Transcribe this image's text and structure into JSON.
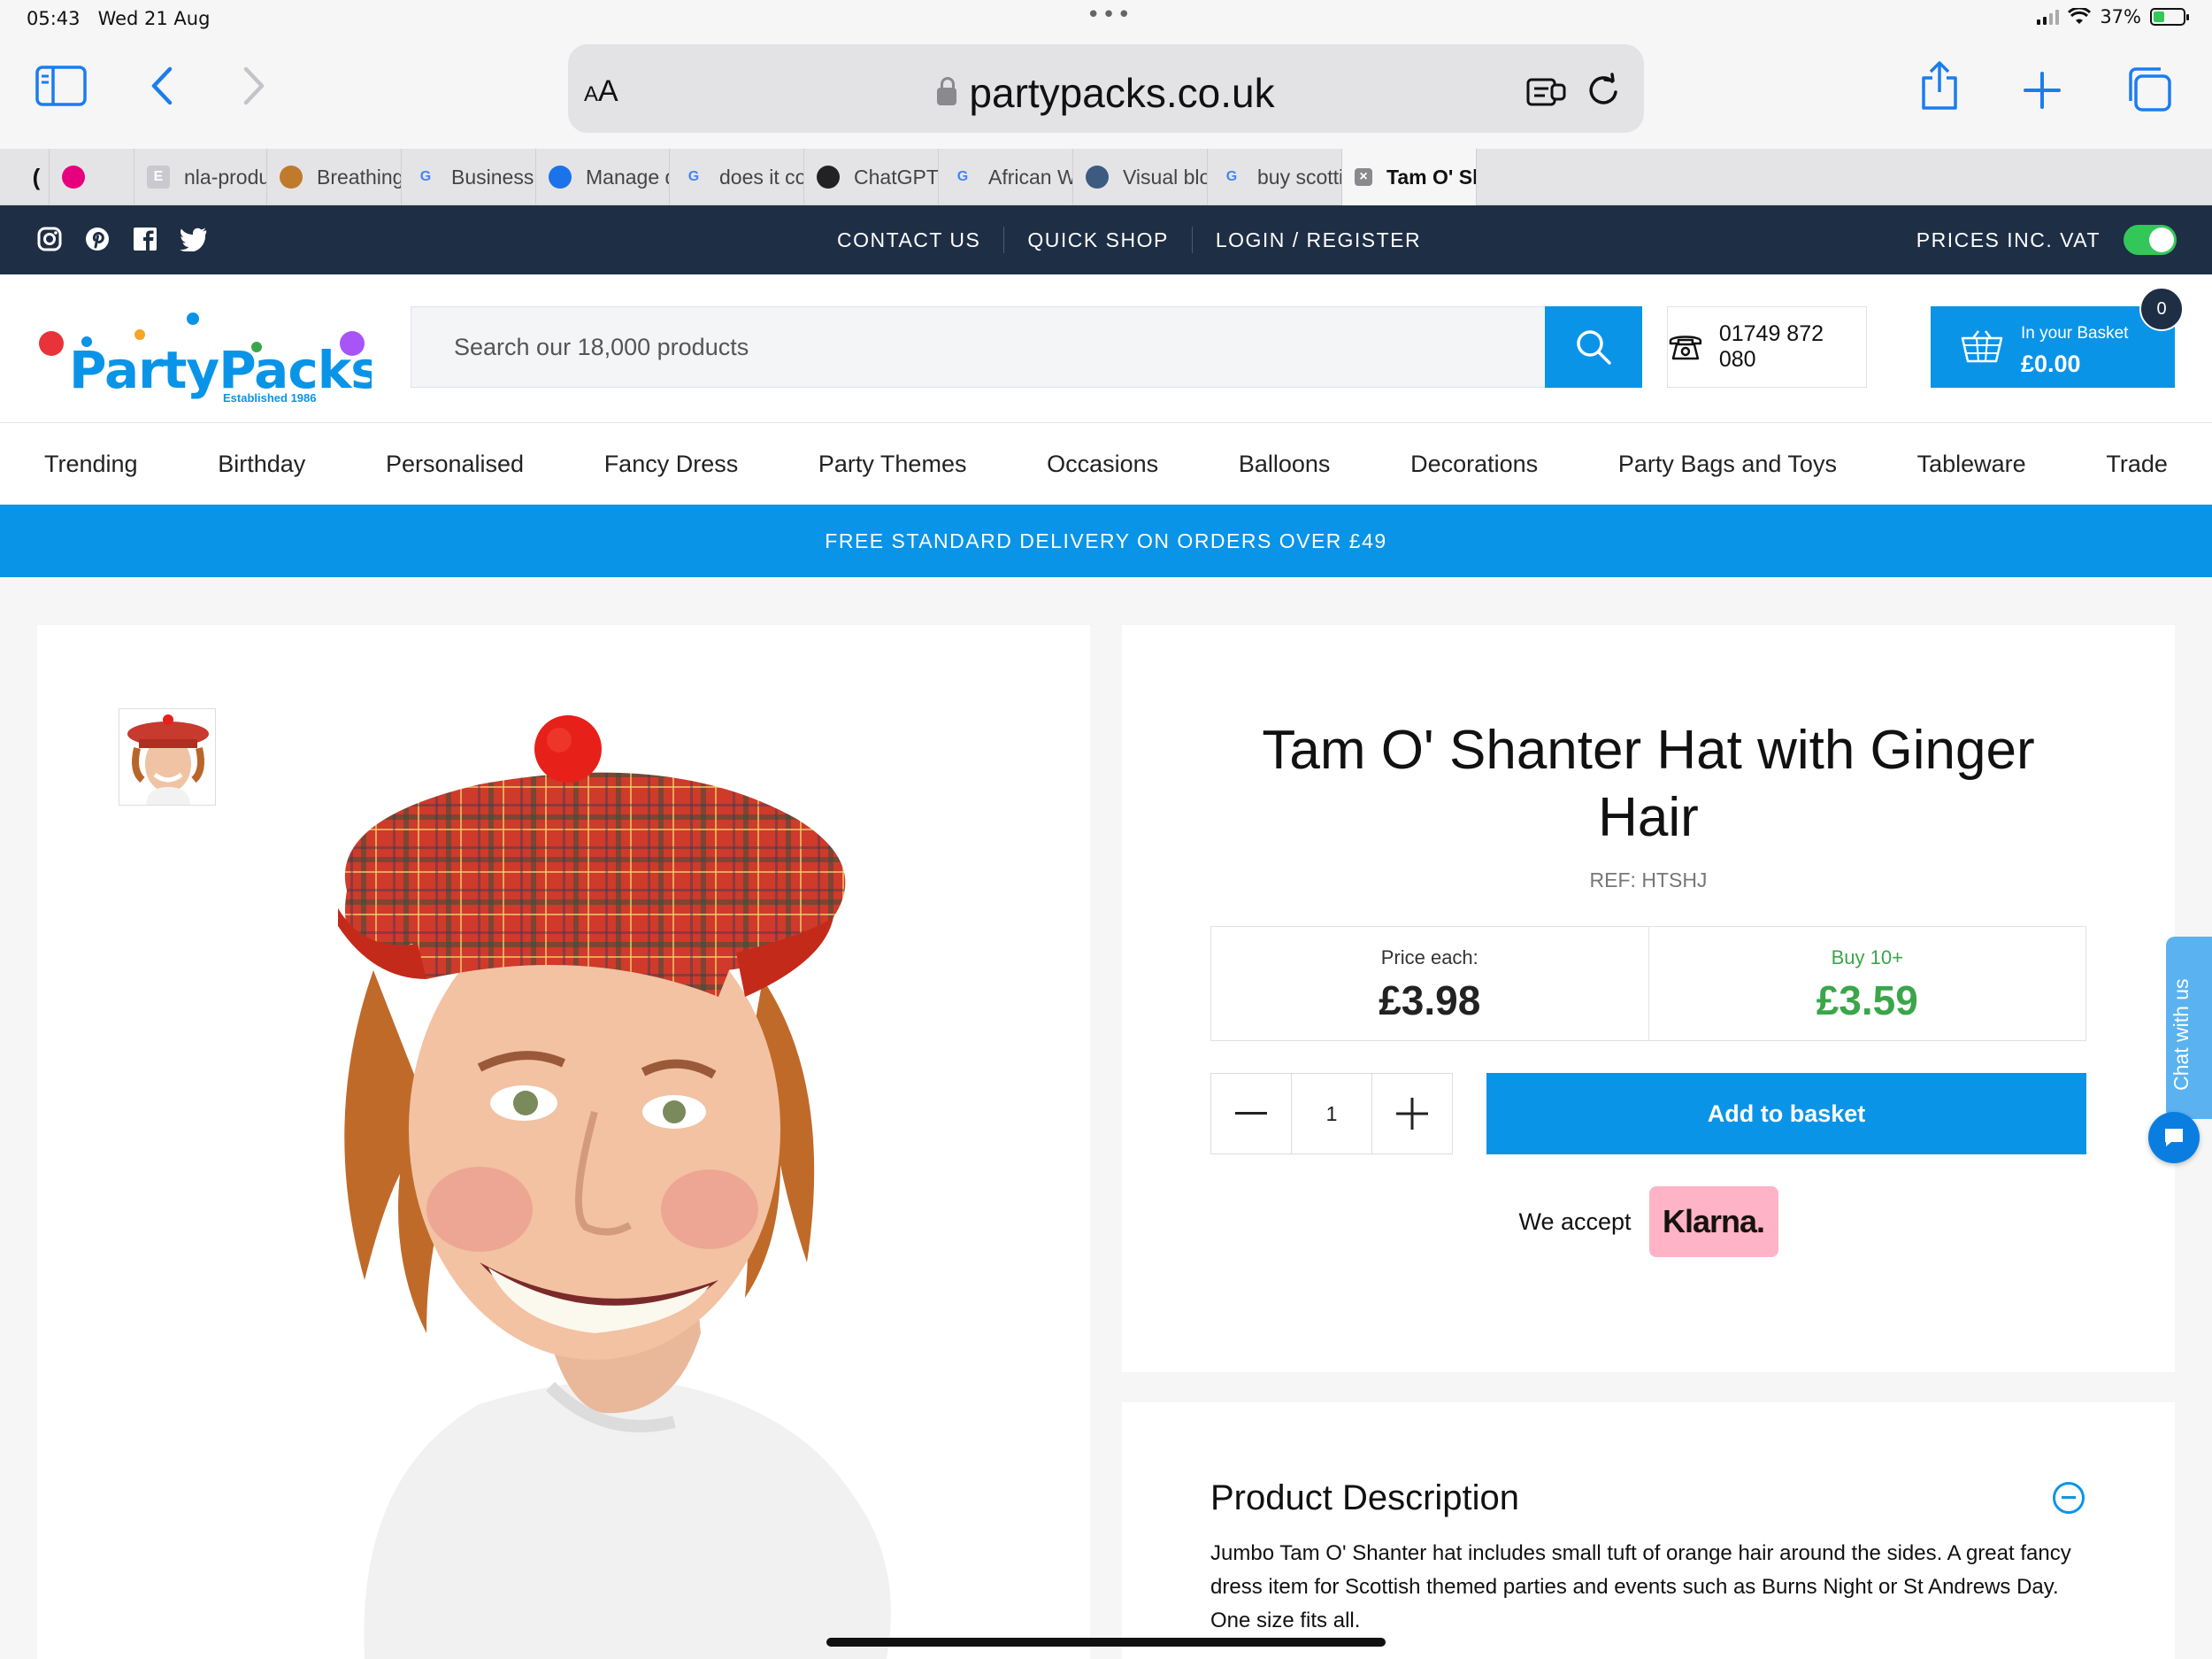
{
  "status_bar": {
    "time": "05:43",
    "date": "Wed 21 Aug",
    "battery": "37%",
    "battery_level": 0.37
  },
  "browser": {
    "aa_label": "AA",
    "url": "partypacks.co.uk",
    "tabs": [
      {
        "label": "",
        "favicon": "tab-favicon-c",
        "color": "#111111"
      },
      {
        "label": "",
        "favicon": "nla-icon",
        "color": "#e6007e"
      },
      {
        "label": "nla-produc",
        "favicon": "e-icon",
        "color": "#c9c9cf"
      },
      {
        "label": "Breathing Int...",
        "favicon": "bowl-icon",
        "color": "#c07a2c"
      },
      {
        "label": "Business str...",
        "favicon": "google-icon",
        "color": "#4285f4"
      },
      {
        "label": "Manage dom...",
        "favicon": "hexagon-icon",
        "color": "#1a73e8"
      },
      {
        "label": "does it cost...",
        "favicon": "google-icon",
        "color": "#4285f4"
      },
      {
        "label": "ChatGPT",
        "favicon": "openai-icon",
        "color": "#222222"
      },
      {
        "label": "African Wax...",
        "favicon": "google-icon",
        "color": "#4285f4"
      },
      {
        "label": "Visual blog...",
        "favicon": "globe-icon",
        "color": "#3d5a80"
      },
      {
        "label": "buy scottish...",
        "favicon": "google-icon",
        "color": "#4285f4"
      },
      {
        "label": "Tam O' Shan...",
        "favicon": "close-tab-icon",
        "color": "#666666"
      }
    ]
  },
  "site": {
    "top_links": [
      "CONTACT US",
      "QUICK SHOP",
      "LOGIN / REGISTER"
    ],
    "vat_label": "PRICES INC. VAT",
    "logo_text": "PartyPacks",
    "logo_tagline": "Established 1986",
    "search_placeholder": "Search our 18,000 products",
    "phone": "01749 872 080",
    "basket_label": "In your Basket",
    "basket_amount": "£0.00",
    "basket_count": "0",
    "categories": [
      "Trending",
      "Birthday",
      "Personalised",
      "Fancy Dress",
      "Party Themes",
      "Occasions",
      "Balloons",
      "Decorations",
      "Party Bags and Toys",
      "Tableware",
      "Trade"
    ],
    "promo": "FREE STANDARD DELIVERY ON ORDERS OVER £49"
  },
  "product": {
    "title": "Tam O' Shanter Hat with Ginger Hair",
    "ref": "REF: HTSHJ",
    "price_label": "Price each:",
    "price": "£3.98",
    "bulk_label": "Buy 10+",
    "bulk_price": "£3.59",
    "quantity": "1",
    "add_label": "Add to basket",
    "accept_label": "We accept",
    "klarna": "Klarna.",
    "description_heading": "Product Description",
    "description": "Jumbo Tam O' Shanter hat includes small tuft of orange hair around the sides. A great fancy dress item for Scottish themed parties and events such as Burns Night or St Andrews Day. One size fits all."
  },
  "chat": {
    "label": "Chat with us"
  },
  "colors": {
    "brand_blue": "#0a94e8",
    "navy": "#1e2e45",
    "green": "#3aa64a",
    "klarna_pink": "#ffb3c7"
  }
}
